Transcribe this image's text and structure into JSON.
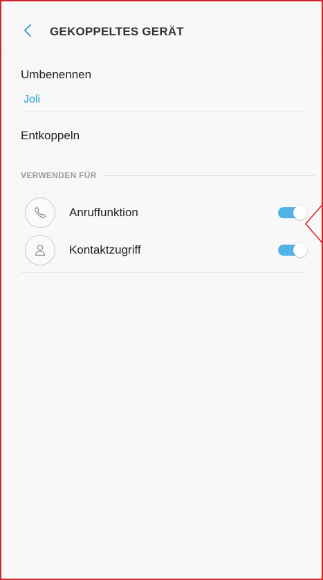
{
  "header": {
    "title": "GEKOPPELTES GERÄT",
    "back_icon": "chevron-left-icon"
  },
  "rename": {
    "label": "Umbenennen",
    "value": "Joli"
  },
  "unpair": {
    "label": "Entkoppeln"
  },
  "section": {
    "label": "VERWENDEN FÜR"
  },
  "items": [
    {
      "label": "Anruffunktion",
      "icon": "phone-icon",
      "enabled": true
    },
    {
      "label": "Kontaktzugriff",
      "icon": "person-icon",
      "enabled": true
    }
  ],
  "colors": {
    "accent": "#1da1df",
    "toggle_on": "#50b5e6",
    "frame_border": "#d3262b"
  }
}
